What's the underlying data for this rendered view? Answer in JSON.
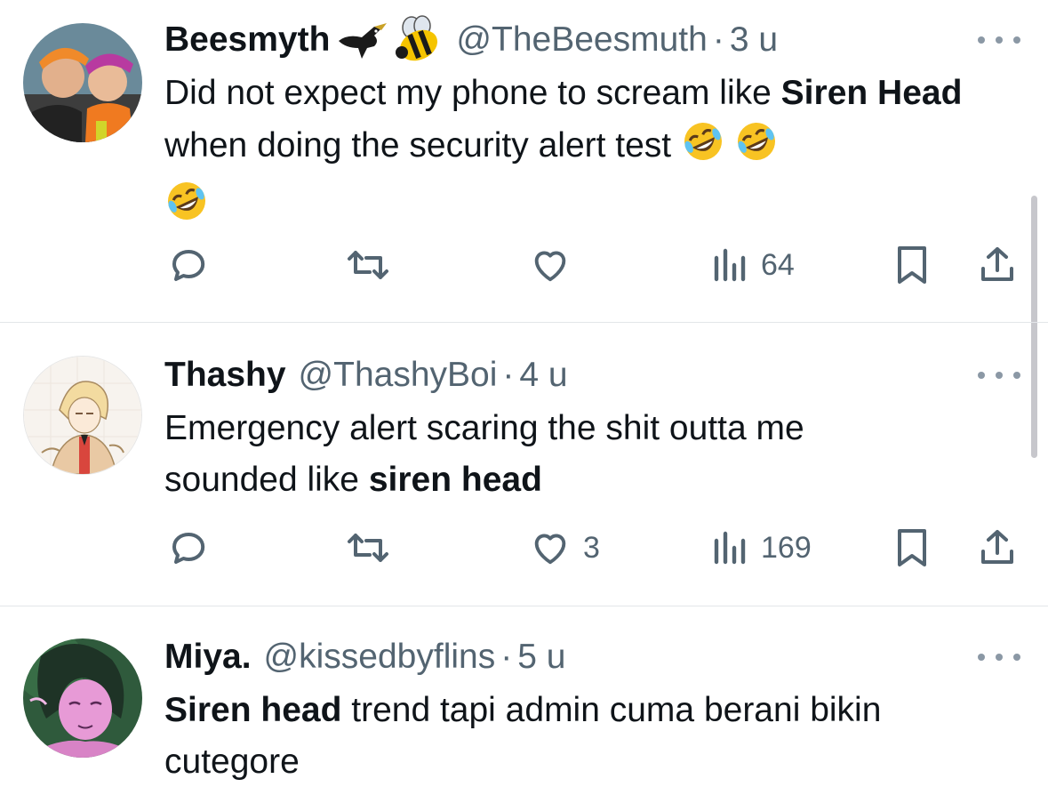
{
  "tweets": [
    {
      "name": "Beesmyth",
      "badges": [
        "blackbird-emoji",
        "bee-emoji"
      ],
      "handle": "@TheBeesmuth",
      "dot": "·",
      "time": "3 u",
      "text_segments": [
        {
          "text": "Did not expect my phone to scream like ",
          "bold": false
        },
        {
          "text": "Siren Head",
          "bold": true
        },
        {
          "text": " when doing the security alert test ",
          "bold": false
        }
      ],
      "emoji_count": 3,
      "emoji": "rolling-on-floor-laughing-emoji",
      "replies": "",
      "retweets": "",
      "likes": "",
      "views": "64"
    },
    {
      "name": "Thashy",
      "handle": "@ThashyBoi",
      "dot": "·",
      "time": "4 u",
      "text_line1": "Emergency alert scaring the shit outta me",
      "text_line2_plain": "sounded like ",
      "text_line2_bold": "siren head",
      "replies": "",
      "retweets": "",
      "likes": "3",
      "views": "169"
    },
    {
      "name": "Miya.",
      "handle": "@kissedbyflins",
      "dot": "·",
      "time": "5 u",
      "text_bold": "Siren head",
      "text_rest": " trend tapi admin cuma berani bikin",
      "text_line2": "cutegore"
    }
  ],
  "icons": {
    "reply": "reply-icon",
    "retweet": "retweet-icon",
    "like": "heart-icon",
    "views": "views-icon",
    "bookmark": "bookmark-icon",
    "share": "share-icon",
    "more": "more-icon"
  },
  "colors": {
    "text": "#0f1419",
    "secondary": "#536471",
    "divider": "#e3e6e9"
  }
}
